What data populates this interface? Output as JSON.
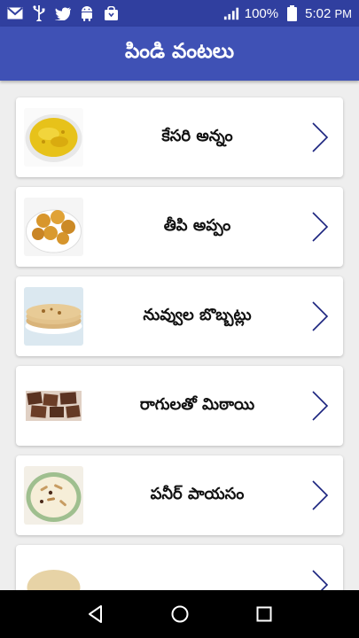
{
  "status_bar": {
    "battery_percent": "100%",
    "time": "5:02",
    "ampm": "PM",
    "icons": [
      "gmail-icon",
      "usb-icon",
      "twitter-icon",
      "android-icon",
      "shopping-bag-icon",
      "signal-icon",
      "battery-icon"
    ]
  },
  "app_bar": {
    "title": "పిండి వంటలు",
    "color": "#3f51b5",
    "status_color": "#303f9f"
  },
  "recipes": [
    {
      "label": "కేసరి అన్నం",
      "thumb": "kesari-rice-thumbnail"
    },
    {
      "label": "తీపి అప్పం",
      "thumb": "sweet-appam-thumbnail"
    },
    {
      "label": "నువ్వుల బొబ్బట్లు",
      "thumb": "sesame-bobbatlu-thumbnail"
    },
    {
      "label": "రాగులతో మిఠాయి",
      "thumb": "ragi-sweet-thumbnail"
    },
    {
      "label": "పనీర్ పాయసం",
      "thumb": "paneer-payasam-thumbnail"
    },
    {
      "label": "",
      "thumb": "partial-item-thumbnail"
    }
  ],
  "nav_bar": {
    "buttons": [
      "back-icon",
      "home-icon",
      "recents-icon"
    ]
  },
  "accent": "#1a237e"
}
